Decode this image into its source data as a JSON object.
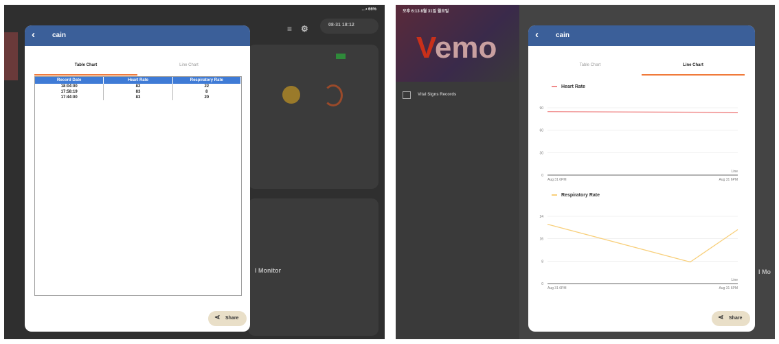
{
  "left": {
    "status_bar": "…• 66%",
    "bg_time": "08-31 18:12",
    "bg_partial_label": "l Monitor",
    "modal": {
      "title": "cain",
      "tabs": [
        {
          "label": "Table Chart",
          "active": true
        },
        {
          "label": "Line Chart",
          "active": false
        }
      ],
      "table": {
        "headers": [
          "Record Date",
          "Heart Rate",
          "Respiratory Rate"
        ],
        "rows": [
          [
            "18:04:00",
            "82",
            "22"
          ],
          [
            "17:58:19",
            "83",
            "8"
          ],
          [
            "17:44:00",
            "83",
            "20"
          ]
        ]
      },
      "share_label": "Share"
    }
  },
  "right": {
    "status_bar": "오후 6:13 8월 31일 월요일",
    "app_logo": "emo",
    "sidebar_item": "Vital Signs Records",
    "bg_partial_label": "I Mo",
    "modal": {
      "title": "cain",
      "tabs": [
        {
          "label": "Table Chart",
          "active": false
        },
        {
          "label": "Line Chart",
          "active": true
        }
      ],
      "share_label": "Share"
    }
  },
  "colors": {
    "header": "#3b5f99",
    "accent": "#f07a3a",
    "table_header": "#3f7bd6",
    "heart": "#f08a8a",
    "resp": "#f8cf7a"
  },
  "chart_data": [
    {
      "type": "line",
      "title": "Heart Rate",
      "x": [
        "Aug 31 6PM",
        "Aug 31 6PM"
      ],
      "series": [
        {
          "name": "Heart Rate",
          "values": [
            84,
            83
          ]
        }
      ],
      "yticks": [
        "0",
        "30",
        "60",
        "90"
      ],
      "ylim": [
        0,
        100
      ],
      "bottom_right_label": "Line",
      "legend": "top-left",
      "grid": true
    },
    {
      "type": "line",
      "title": "Respiratory Rate",
      "x": [
        "Aug 31 6PM",
        "Aug 31 6PM"
      ],
      "series": [
        {
          "name": "Respiratory Rate",
          "values": [
            22,
            8,
            20
          ]
        }
      ],
      "yticks": [
        "0",
        "8",
        "16",
        "24"
      ],
      "ylim": [
        0,
        28
      ],
      "bottom_right_label": "Line",
      "legend": "top-left",
      "grid": true
    }
  ]
}
